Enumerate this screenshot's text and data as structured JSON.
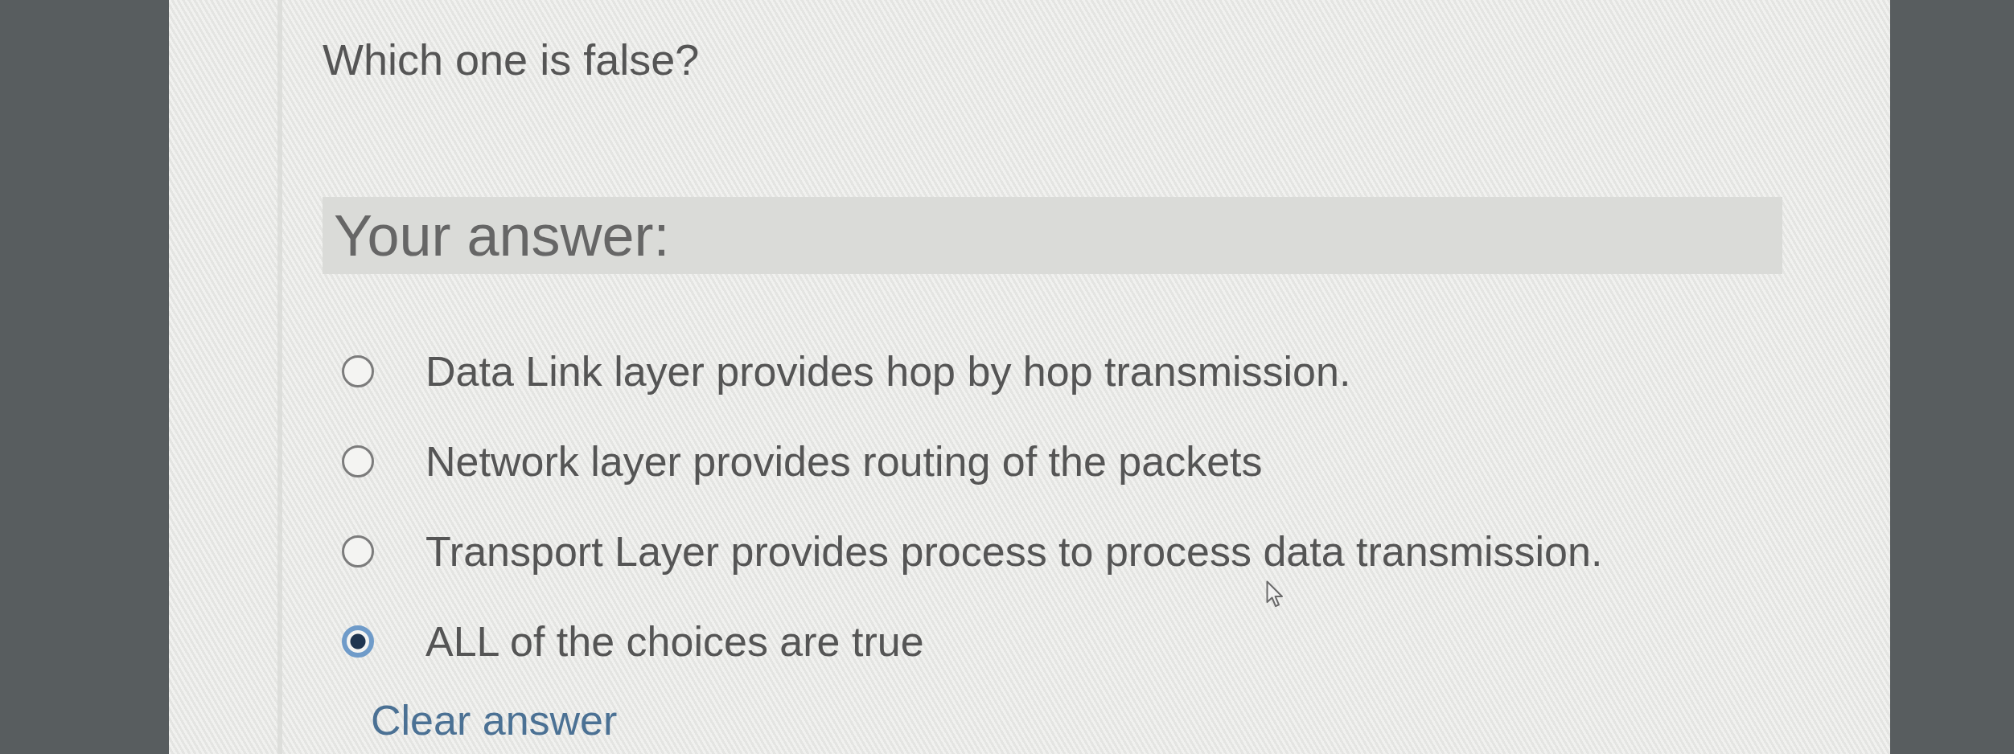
{
  "question": {
    "text": "Which one is false?"
  },
  "answer_heading": {
    "text": "Your answer:"
  },
  "options": [
    {
      "label": "Data Link layer provides hop by hop transmission.",
      "selected": false
    },
    {
      "label": "Network layer provides routing of the packets",
      "selected": false
    },
    {
      "label": "Transport Layer provides process to process data transmission.",
      "selected": false
    },
    {
      "label": "ALL of the choices are true",
      "selected": true
    }
  ],
  "clear_link": {
    "text": "Clear answer"
  }
}
